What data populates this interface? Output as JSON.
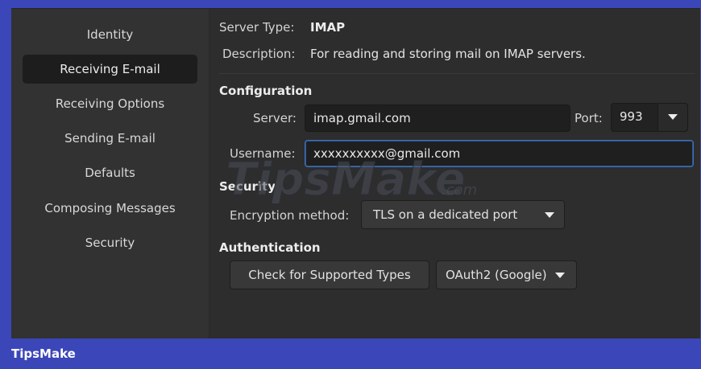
{
  "sidebar": {
    "items": [
      {
        "label": "Identity"
      },
      {
        "label": "Receiving E-mail"
      },
      {
        "label": "Receiving Options"
      },
      {
        "label": "Sending E-mail"
      },
      {
        "label": "Defaults"
      },
      {
        "label": "Composing Messages"
      },
      {
        "label": "Security"
      }
    ],
    "active_index": 1
  },
  "server_info": {
    "type_label": "Server Type:",
    "type_value": "IMAP",
    "description_label": "Description:",
    "description_value": "For reading and storing mail on IMAP servers."
  },
  "configuration": {
    "heading": "Configuration",
    "server_label": "Server:",
    "server_value": "imap.gmail.com",
    "port_label": "Port:",
    "port_value": "993",
    "username_label": "Username:",
    "username_value": "xxxxxxxxxx@gmail.com"
  },
  "security": {
    "heading": "Security",
    "encryption_label": "Encryption method:",
    "encryption_value": "TLS on a dedicated port"
  },
  "authentication": {
    "heading": "Authentication",
    "check_button": "Check for Supported Types",
    "method_value": "OAuth2 (Google)"
  },
  "watermark": {
    "text": "TipsMake",
    "suffix": ".com"
  },
  "footer": {
    "brand": "TipsMake"
  },
  "colors": {
    "footer_bg": "#3b46b8",
    "focus_border": "#3d6fbd",
    "window_bg": "#2d2d2d"
  },
  "icons": [
    "chevron-down-icon"
  ]
}
